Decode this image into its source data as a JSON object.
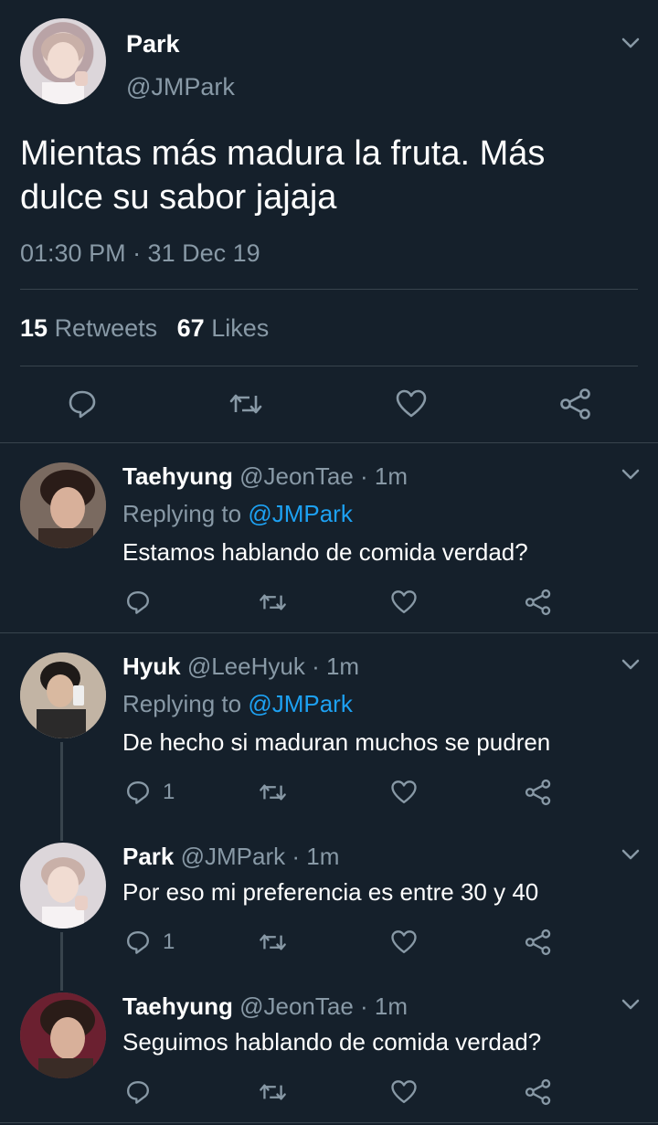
{
  "main_tweet": {
    "name": "Park",
    "handle": "@JMPark",
    "text_line1": "Mientas más madura la fruta. Más",
    "text_line2": "dulce su sabor jajaja",
    "timestamp": "01:30 PM · 31 Dec 19",
    "retweets_count": "15",
    "retweets_label": "Retweets",
    "likes_count": "67",
    "likes_label": "Likes"
  },
  "replies": [
    {
      "name": "Taehyung",
      "handle": "@JeonTae",
      "time": "· 1m",
      "replying_label": "Replying to",
      "replying_to": "@JMPark",
      "text": "Estamos hablando de comida verdad?",
      "reply_count": ""
    },
    {
      "name": "Hyuk",
      "handle": "@LeeHyuk",
      "time": "· 1m",
      "replying_label": "Replying to",
      "replying_to": "@JMPark",
      "text": "De hecho si maduran muchos se pudren",
      "reply_count": "1"
    },
    {
      "name": "Park",
      "handle": "@JMPark",
      "time": "· 1m",
      "text": "Por eso mi preferencia es entre 30 y 40",
      "reply_count": "1"
    },
    {
      "name": "Taehyung",
      "handle": "@JeonTae",
      "time": "· 1m",
      "text": "Seguimos hablando de comida verdad?",
      "reply_count": ""
    }
  ],
  "colors": {
    "background": "#15202b",
    "muted": "#8899a6",
    "link": "#1da1f2",
    "divider": "#38444d"
  }
}
